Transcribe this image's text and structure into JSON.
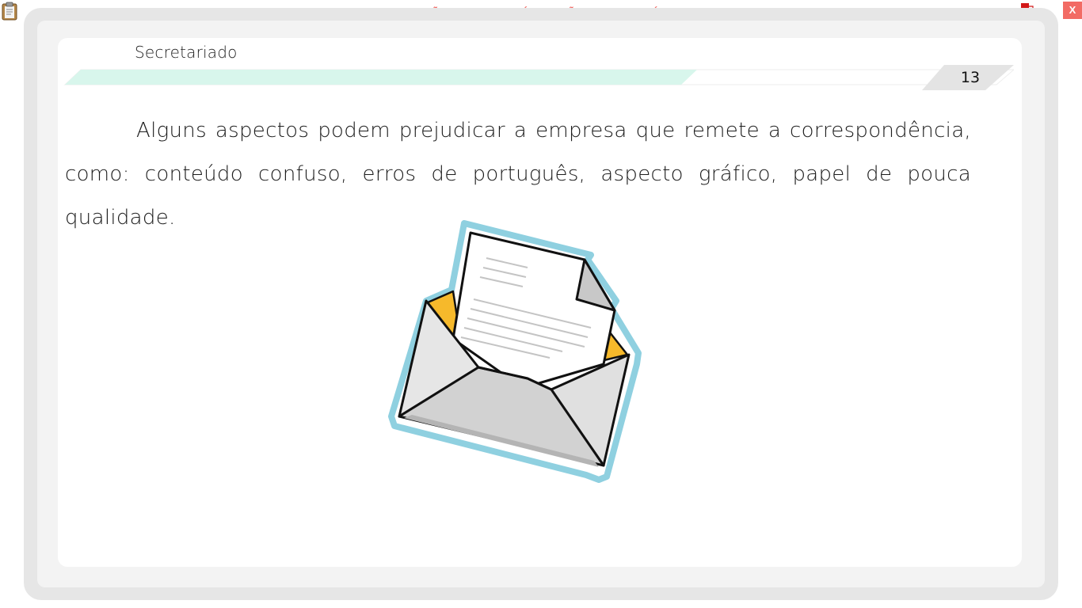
{
  "toolbar": {
    "watermark": "VERSÃO PARA FUNCIONÁRIOS - NÃO COMERCIALIZÁVEL",
    "close_label": "X",
    "icons": [
      "clipboard-icon",
      "network-icon",
      "close-icon"
    ]
  },
  "header": {
    "section_title": "Secretariado",
    "page_number": "13"
  },
  "content": {
    "paragraph": "Alguns aspectos podem prejudicar a empresa que remete a correspondência, como: conteúdo confuso, erros de português, aspecto gráfico, papel de pouca qualidade.",
    "illustration": "open-envelope-with-letter"
  },
  "colors": {
    "watermark": "#f0504a",
    "close_button": "#f26b64",
    "header_band": "#d8f6ec",
    "envelope_outline": "#8fd0e0",
    "envelope_flap": "#f6b92b"
  }
}
